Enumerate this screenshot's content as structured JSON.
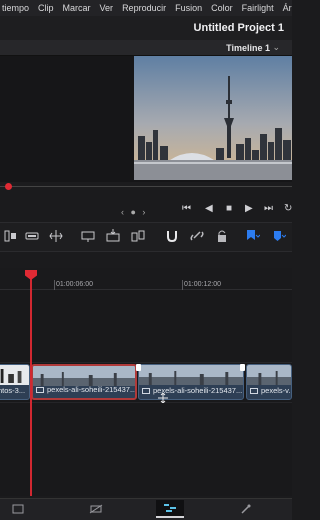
{
  "menu": {
    "items": [
      "tiempo",
      "Clip",
      "Marcar",
      "Ver",
      "Reproducir",
      "Fusion",
      "Color",
      "Fairlight",
      "Áre"
    ]
  },
  "project": {
    "title": "Untitled Project 1"
  },
  "timeline": {
    "name": "Timeline 1",
    "dropdown_icon": "chevron-down-icon"
  },
  "viewer": {
    "content": "city-skyline-image"
  },
  "transport": {
    "nav_dots": "‹ ● ›",
    "buttons": [
      "skip-to-start-icon",
      "step-back-icon",
      "stop-icon",
      "play-icon",
      "skip-to-end-icon",
      "loop-icon"
    ]
  },
  "ruler": {
    "timecodes": [
      "01:00:06:00",
      "01:00:12:00"
    ]
  },
  "clips": [
    {
      "label": "ntos-3..."
    },
    {
      "label": "pexels-ali-soheili-215437..."
    },
    {
      "label": "pexels-ali-soheili-215437..."
    },
    {
      "label": "pexels-v..."
    }
  ],
  "pages": [
    "media-page-icon",
    "cut-page-icon",
    "edit-page-icon",
    "color-page-icon"
  ],
  "colors": {
    "playhead": "#e02a34",
    "selection": "#b03a3a",
    "clip": "#2e3f55",
    "flag": "#2c7cf0"
  }
}
